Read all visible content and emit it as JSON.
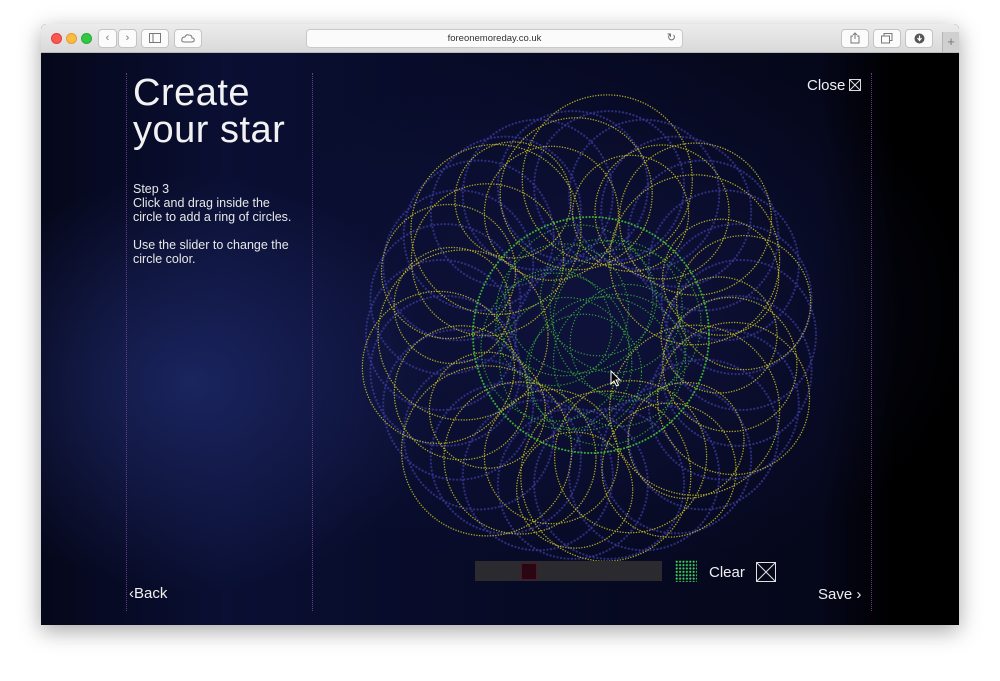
{
  "browser": {
    "url": "foreonemoreday.co.uk"
  },
  "page": {
    "title_line1": "Create",
    "title_line2": "your star",
    "step_label": "Step 3",
    "step_text": "Click and drag inside the circle to add a ring of circles.",
    "hint_text": "Use the slider to change the circle color.",
    "close_label": "Close",
    "back_label": "Back",
    "save_label": "Save",
    "clear_label": "Clear"
  },
  "color_slider": {
    "value_fraction": 0.27,
    "selected_color": "#3ed35a",
    "thumb_color": "#2a0512"
  },
  "palette": {
    "outer_ring_color": "#c8c02a",
    "inner_ring_color": "#3fbf3a",
    "background_ring_color": "#3a3a9a"
  },
  "icons": {
    "close": "close-box-icon",
    "back": "chevron-left-icon",
    "save": "chevron-right-icon",
    "clear": "clear-box-icon",
    "cursor": "mouse-cursor-icon"
  }
}
